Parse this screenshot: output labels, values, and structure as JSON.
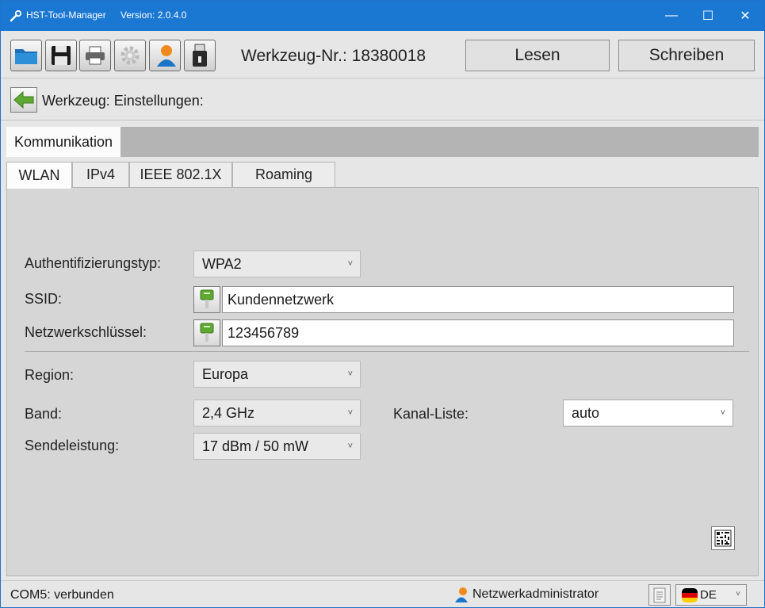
{
  "window": {
    "title": "HST-Tool-Manager",
    "version": "Version: 2.0.4.0",
    "minimize_glyph": "—",
    "maximize_glyph": "☐",
    "close_glyph": "✕"
  },
  "toolbar": {
    "tool_number": "Werkzeug-Nr.: 18380018",
    "read_label": "Lesen",
    "write_label": "Schreiben",
    "icons": [
      "folder-icon",
      "save-icon",
      "printer-icon",
      "settings-icon",
      "user-icon",
      "usb-icon"
    ]
  },
  "nav": {
    "title": "Werkzeug: Einstellungen:"
  },
  "tabs_outer": [
    "Kommunikation"
  ],
  "tabs_inner": [
    "WLAN",
    "IPv4",
    "IEEE 802.1X",
    "Roaming"
  ],
  "form": {
    "auth_label": "Authentifizierungstyp:",
    "auth_value": "WPA2",
    "ssid_label": "SSID:",
    "ssid_value": "Kundennetzwerk",
    "key_label": "Netzwerkschlüssel:",
    "key_value": "123456789",
    "region_label": "Region:",
    "region_value": "Europa",
    "band_label": "Band:",
    "band_value": "2,4 GHz",
    "channel_label": "Kanal-Liste:",
    "channel_value": "auto",
    "power_label": "Sendeleistung:",
    "power_value": "17 dBm / 50 mW"
  },
  "status": {
    "connection": "COM5: verbunden",
    "role": "Netzwerkadministrator",
    "language": "DE"
  },
  "colors": {
    "titlebar": "#1a77d2",
    "panel": "#d6d6d6",
    "accent_green": "#5fa832",
    "flag_black": "#000000",
    "flag_red": "#dd0000",
    "flag_gold": "#ffce00"
  }
}
